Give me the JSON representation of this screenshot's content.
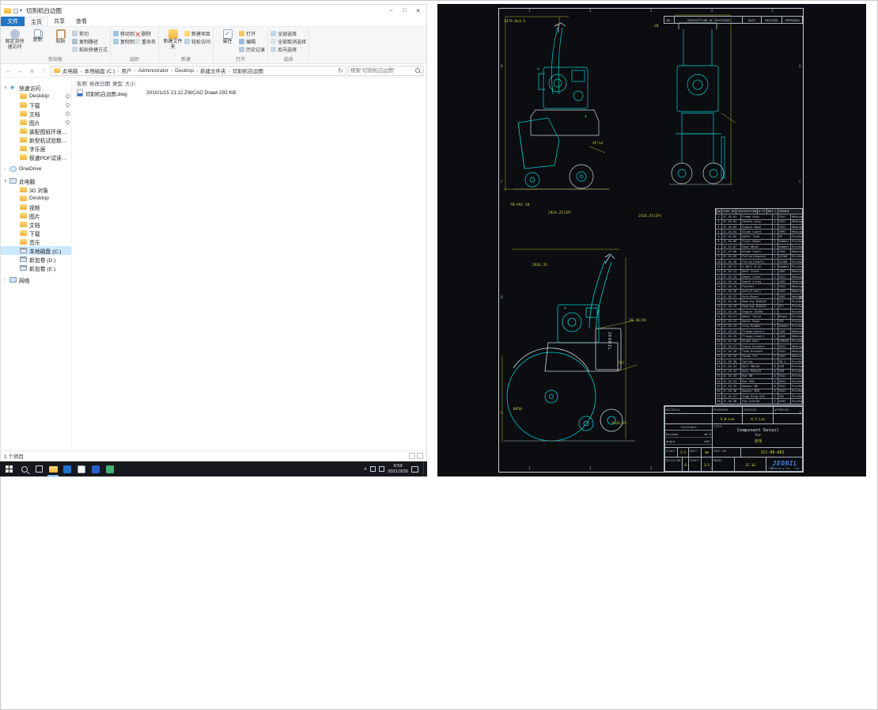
{
  "explorer": {
    "title": "切割机白边图",
    "window": {
      "minimize": "–",
      "maximize": "□",
      "close": "✕"
    },
    "tabs": {
      "file": "文件",
      "others": [
        "主页",
        "共享",
        "查看"
      ]
    },
    "ribbon": {
      "pin_quick": "固定到快速访问",
      "copy": "复制",
      "paste": "粘贴",
      "cut": "剪切",
      "copy_path": "复制路径",
      "paste_shortcut": "粘贴快捷方式",
      "g1": "剪贴板",
      "move_to": "移动到",
      "copy_to": "复制到",
      "delete": "删除",
      "rename": "重命名",
      "g2": "组织",
      "new_folder": "新建文件夹",
      "new_item": "新建项目",
      "easy_access": "轻松访问",
      "g3": "新建",
      "properties": "属性",
      "open": "打开",
      "edit": "编辑",
      "history": "历史记录",
      "g4": "打开",
      "select_all": "全部选择",
      "select_none": "全部取消选择",
      "invert": "反向选择",
      "g5": "选择"
    },
    "nav": {
      "back": "←",
      "forward": "→",
      "recent": "∨",
      "up": "↑",
      "refresh": "↻"
    },
    "breadcrumb": [
      "此电脑",
      "本地磁盘 (C:)",
      "用户",
      "Administrator",
      "Desktop",
      "新建文件夹",
      "切割机白边图"
    ],
    "search": {
      "placeholder": "搜索\"切割机白边图\""
    },
    "columns": [
      "名称",
      "修改日期",
      "类型",
      "大小"
    ],
    "files": [
      {
        "name": "切割机白边图.dwg",
        "date": "2010/1/15 21:22",
        "type": "ZWCAD Drawing",
        "size": "292 KB"
      }
    ],
    "sidebar": [
      {
        "chev": "∨",
        "icon": "star",
        "label": "快速访问",
        "level": 0
      },
      {
        "chev": "",
        "icon": "folder",
        "label": "Desktop",
        "level": 1,
        "pinned": true
      },
      {
        "chev": "",
        "icon": "download",
        "label": "下载",
        "level": 1,
        "pinned": true
      },
      {
        "chev": "",
        "icon": "doc",
        "label": "文档",
        "level": 1,
        "pinned": true
      },
      {
        "chev": "",
        "icon": "pic",
        "label": "图片",
        "level": 1,
        "pinned": true
      },
      {
        "chev": "",
        "icon": "folder",
        "label": "装配图纸环境监控",
        "level": 1
      },
      {
        "chev": "",
        "icon": "folder",
        "label": "新型机试验数据归档",
        "level": 1
      },
      {
        "chev": "",
        "icon": "folder",
        "label": "字乐居",
        "level": 1
      },
      {
        "chev": "",
        "icon": "folder",
        "label": "极速PDF试读器内置",
        "level": 1
      },
      {
        "chev": "›",
        "icon": "cloud",
        "label": "OneDrive",
        "level": 0
      },
      {
        "chev": "∨",
        "icon": "pc",
        "label": "此电脑",
        "level": 0
      },
      {
        "chev": "",
        "icon": "folder",
        "label": "3D 对象",
        "level": 1
      },
      {
        "chev": "",
        "icon": "folder",
        "label": "Desktop",
        "level": 1
      },
      {
        "chev": "",
        "icon": "video",
        "label": "视频",
        "level": 1
      },
      {
        "chev": "",
        "icon": "pic",
        "label": "图片",
        "level": 1
      },
      {
        "chev": "",
        "icon": "doc",
        "label": "文档",
        "level": 1
      },
      {
        "chev": "",
        "icon": "download",
        "label": "下载",
        "level": 1
      },
      {
        "chev": "",
        "icon": "music",
        "label": "音乐",
        "level": 1
      },
      {
        "chev": "",
        "icon": "disk",
        "label": "本地磁盘 (C:)",
        "level": 1,
        "selected": true
      },
      {
        "chev": "",
        "icon": "disk",
        "label": "新加卷 (D:)",
        "level": 1
      },
      {
        "chev": "",
        "icon": "disk",
        "label": "新加卷 (E:)",
        "level": 1
      },
      {
        "chev": "›",
        "icon": "net",
        "label": "网络",
        "level": 0
      }
    ],
    "statusbar": {
      "items": "1 个项目"
    }
  },
  "taskbar": {
    "time": "9:59",
    "date": "2021/3/26",
    "tray_chevron": "∧"
  },
  "cad": {
    "zones_h": [
      "1",
      "2",
      "3",
      "4",
      "5"
    ],
    "zones_v": [
      "D",
      "C",
      "B",
      "A"
    ],
    "revision_table": {
      "no": "NO.",
      "description": "DESCRIPTION OF REVISION",
      "date": "DATE",
      "revised": "REVISED",
      "approved": "APPROVED"
    },
    "parts_header": [
      "NO",
      "PART NO",
      "DESCRIPTION",
      "Q'TY",
      "MAT'L",
      "REMARK"
    ],
    "parts_rows": [
      [
        "1",
        "JC-16-01",
        "Frame Assy",
        "1",
        "SS41",
        "Making"
      ],
      [
        "2",
        "JC-16-02",
        "Handle Assy",
        "1",
        "SS41",
        "Making"
      ],
      [
        "3",
        "JC-16-03",
        "Engine Base",
        "1",
        "SS41",
        "Making"
      ],
      [
        "4",
        "JC-16-04",
        "Blade Guard",
        "1",
        "SPHC",
        "Making"
      ],
      [
        "5",
        "JC-16-05",
        "Water Tank",
        "1",
        "PE",
        "Purchase"
      ],
      [
        "6",
        "JC-16-06",
        "Front Wheel",
        "2",
        "Rubber",
        "Purchase"
      ],
      [
        "7",
        "JC-16-07",
        "Rear Wheel",
        "2",
        "Rubber",
        "Purchase"
      ],
      [
        "8",
        "JC-16-08",
        "Blade Shaft",
        "1",
        "S45C",
        "Making"
      ],
      [
        "9",
        "JC-16-09",
        "Pulley(Engine)",
        "1",
        "GC200",
        "Purchase"
      ],
      [
        "10",
        "JC-16-10",
        "Pulley(Shaft)",
        "1",
        "GC200",
        "Purchase"
      ],
      [
        "11",
        "JC-16-11",
        "V-Belt B-42",
        "2",
        "Rubber",
        "Purchase"
      ],
      [
        "12",
        "JC-16-12",
        "Belt Cover",
        "1",
        "SPHC",
        "Making"
      ],
      [
        "13",
        "JC-16-13",
        "Depth Lever",
        "1",
        "SS41",
        "Making"
      ],
      [
        "14",
        "JC-16-14",
        "Depth Screw",
        "1",
        "S45C",
        "Making"
      ],
      [
        "15",
        "JC-16-15",
        "Pointer",
        "1",
        "SS41",
        "Making"
      ],
      [
        "16",
        "JC-16-16",
        "Axle(Front)",
        "1",
        "S45C",
        "Making"
      ],
      [
        "17",
        "JC-16-17",
        "Axle(Rear)",
        "1",
        "S45C",
        "Making"
      ],
      [
        "18",
        "JC-16-18",
        "Bearing 6204ZZ",
        "2",
        "STC",
        "Purchase"
      ],
      [
        "19",
        "JC-16-19",
        "Bearing 6205ZZ",
        "2",
        "STC",
        "Purchase"
      ],
      [
        "20",
        "JC-16-20",
        "Engine GX390",
        "1",
        "-",
        "Purchase"
      ],
      [
        "21",
        "JC-16-21",
        "Water Valve",
        "1",
        "Brass",
        "Purchase"
      ],
      [
        "22",
        "JC-16-22",
        "Water Hose",
        "1",
        "PVC",
        "Purchase"
      ],
      [
        "23",
        "JC-16-23",
        "Grip Rubber",
        "2",
        "Rubber",
        "Purchase"
      ],
      [
        "24",
        "JC-16-24",
        "Flange(Outer)",
        "1",
        "S45C",
        "Making"
      ],
      [
        "25",
        "JC-16-25",
        "Flange(Inner)",
        "1",
        "S45C",
        "Making"
      ],
      [
        "26",
        "JC-16-26",
        "Blade Bolt",
        "1",
        "SCM435",
        "Purchase"
      ],
      [
        "27",
        "JC-16-27",
        "Guard Bracket",
        "1",
        "SS41",
        "Making"
      ],
      [
        "28",
        "JC-16-28",
        "Tank Bracket",
        "1",
        "SS41",
        "Making"
      ],
      [
        "29",
        "JC-16-29",
        "Hinge Pin",
        "2",
        "S45C",
        "Making"
      ],
      [
        "30",
        "JC-16-30",
        "Spring",
        "1",
        "PW-1",
        "Purchase"
      ],
      [
        "31",
        "JC-16-31",
        "Bolt M8×20",
        "8",
        "SCM",
        "Purchase"
      ],
      [
        "32",
        "JC-16-32",
        "Bolt M10×25",
        "6",
        "SCM",
        "Purchase"
      ],
      [
        "33",
        "JC-16-33",
        "Nut M8",
        "8",
        "SS41",
        "Purchase"
      ],
      [
        "34",
        "JC-16-34",
        "Nut M10",
        "6",
        "SS41",
        "Purchase"
      ],
      [
        "35",
        "JC-16-35",
        "Washer M8",
        "8",
        "SS41",
        "Purchase"
      ],
      [
        "36",
        "JC-16-36",
        "Washer M10",
        "6",
        "SS41",
        "Purchase"
      ],
      [
        "37",
        "JC-16-37",
        "Snap Ring S20",
        "2",
        "SK5",
        "Purchase"
      ],
      [
        "38",
        "JC-16-38",
        "Key 5×5×20",
        "2",
        "S45C",
        "Purchase"
      ]
    ],
    "title_block": {
      "material": "MATERIAL",
      "prepared": "PREPARED",
      "checked": "CHECKED",
      "approved": "APPROVED",
      "sig_prepared": "S.W.Lee",
      "sig_checked": "H.Y.Lim",
      "tolerance": "TOLERANCE",
      "tol": [
        [
          "Decimal",
          "±0.5"
        ],
        [
          "Angle",
          "±30'"
        ]
      ],
      "title_label": "TITLE",
      "title_l1": "Component Detail",
      "title_l2": "for",
      "title_l3": "본체",
      "scale_label": "SCALE",
      "scale": "1/1",
      "unit_label": "UNIT",
      "unit": "mm",
      "part_no_label": "PART NO",
      "part_no": "JCC-06-A02",
      "revision_label": "REVISION",
      "revision": "0",
      "sheet_label": "SHEET",
      "sheet": "1/1",
      "model_label": "MODEL",
      "model": "JC-16",
      "company": "JEONIL",
      "company_sub": "Machinery Co., Ltd."
    },
    "annotations": {
      "a1": "1478.9±3.5",
      "a2": "45°±2",
      "a3": "YB-PVC-18",
      "a4": "2924.25(2P)",
      "a5": "2426.35(2P)",
      "a6": "28",
      "a7": "2926.35",
      "a8": "20.30/26",
      "a9": "757",
      "a10": "2426.35",
      "a11": "Ø450"
    },
    "drawing_label": "JEONIL"
  }
}
